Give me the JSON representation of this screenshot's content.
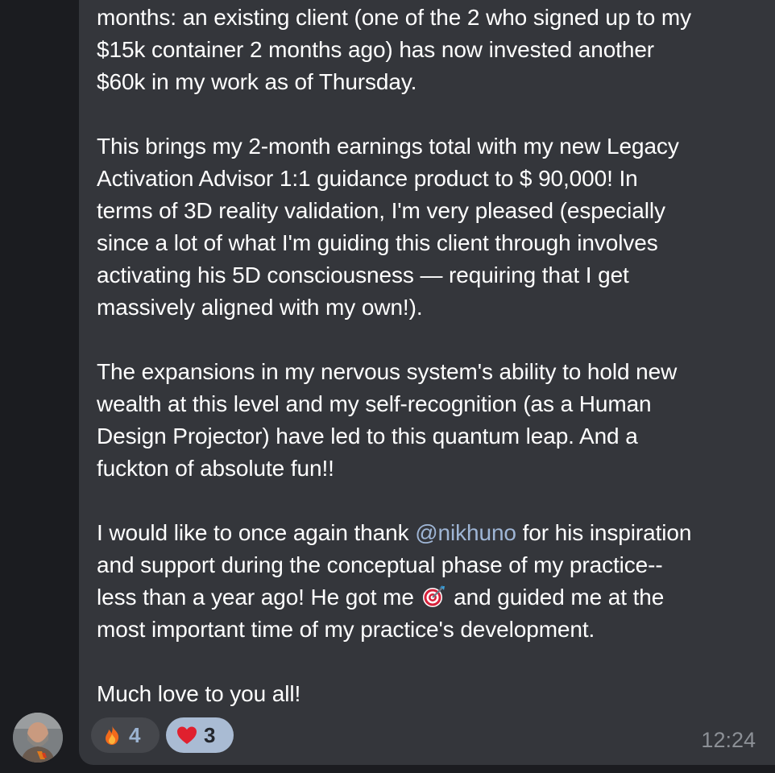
{
  "message": {
    "lines": [
      "months: an existing client (one of the 2 who signed up to my",
      "$15k container 2 months ago) has now invested another",
      "$60k in my work as of Thursday.",
      "This brings my 2-month earnings total with my new Legacy",
      "Activation Advisor 1:1 guidance product to $ 90,000! In",
      "terms of 3D reality validation, I'm very pleased (especially",
      "since a lot of what I'm guiding this client through involves",
      "activating his 5D consciousness — requiring that I get",
      "massively aligned with my own!).",
      "The expansions in my nervous system's ability to hold new",
      "wealth at this level and my self-recognition (as a Human",
      "Design Projector) have led to this quantum leap. And a",
      "fuckton of absolute fun!!",
      "and support during the conceptual phase of my practice--",
      "most important time of my practice's development.",
      "Much love to you all!"
    ],
    "thank_pre": "I would like to once again thank ",
    "mention": "@nikhuno",
    "thank_post": " for his inspiration",
    "got_pre": "less than a year ago! He got me ",
    "got_emoji": "direct-hit-icon",
    "got_post": " and guided me at the"
  },
  "reactions": [
    {
      "emoji": "fire-icon",
      "count": "4",
      "selected": false
    },
    {
      "emoji": "heart-icon",
      "count": "3",
      "selected": true
    }
  ],
  "time": "12:24",
  "colors": {
    "background": "#1b1c20",
    "bubble": "#34363b",
    "text": "#ffffff",
    "mention": "#9fb6d6",
    "reaction_selected": "#a9bbd3",
    "reaction_default": "#45474c",
    "time": "#8c9096"
  }
}
